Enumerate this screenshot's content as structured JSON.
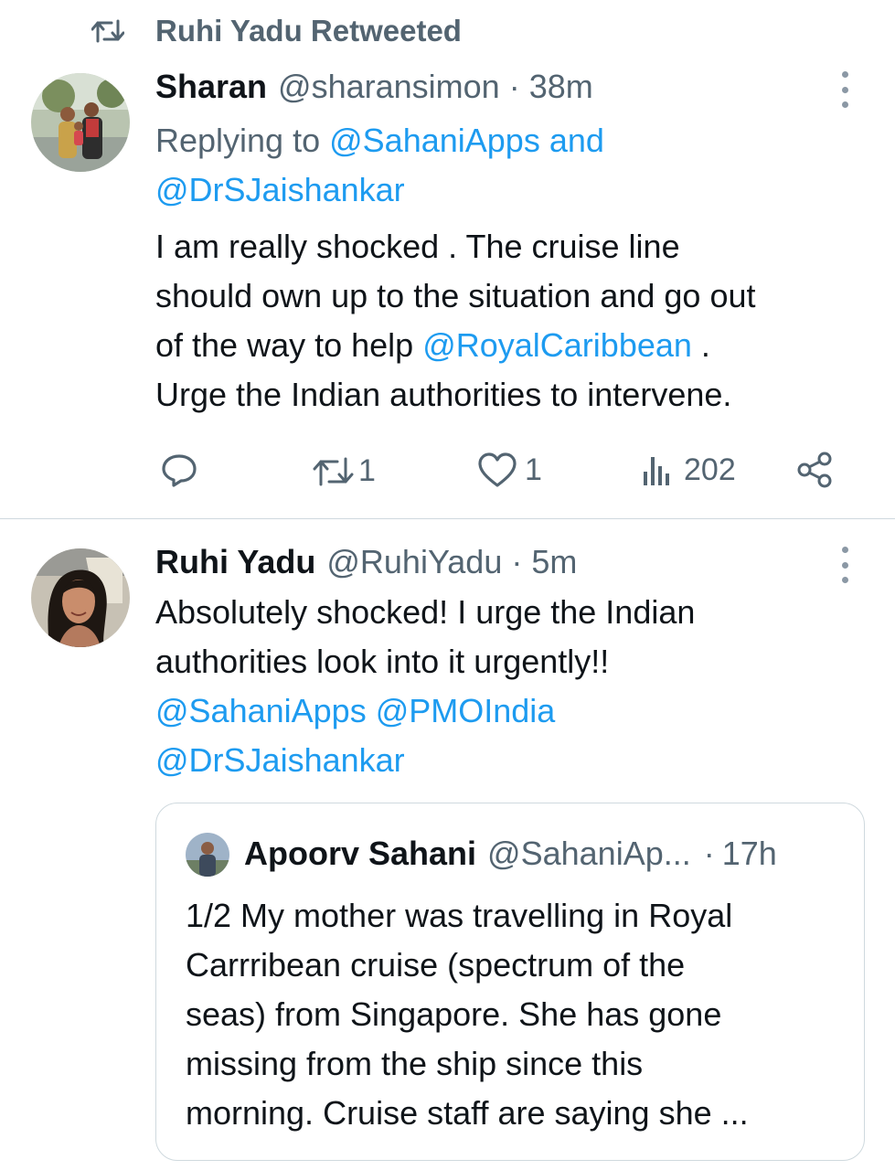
{
  "retweet_header": {
    "label": "Ruhi Yadu Retweeted",
    "icon": "retweet-icon"
  },
  "tweets": [
    {
      "name": "Sharan",
      "handle": "@sharansimon",
      "separator": "·",
      "time": "38m",
      "reply_prefix": "Replying to",
      "reply_handle_1": "@SahaniApps",
      "reply_and": "and",
      "reply_handle_2": "@DrSJaishankar",
      "text_line_1": "I am really shocked . The cruise line",
      "text_line_2": "should own up to the situation and go out",
      "text_line_3a": "of the way to help",
      "text_mention": "@RoyalCaribbean",
      "text_line_3b": ".",
      "text_line_4": "Urge the Indian authorities to intervene.",
      "actions": {
        "retweets": "1",
        "likes": "1",
        "views": "202"
      }
    },
    {
      "name": "Ruhi Yadu",
      "handle": "@RuhiYadu",
      "separator": "·",
      "time": "5m",
      "text_line_1": "Absolutely shocked! I urge the Indian",
      "text_line_2": "authorities look into it urgently!!",
      "mention_1": "@SahaniApps",
      "mention_2": "@PMOIndia",
      "mention_3": "@DrSJaishankar",
      "quote": {
        "name": "Apoorv Sahani",
        "handle": "@SahaniAp...",
        "separator": "·",
        "time": "17h",
        "lines": [
          "1/2 My mother was travelling in Royal",
          "Carrribean cruise (spectrum of the",
          "seas) from Singapore. She has gone",
          "missing from the ship since this",
          "morning. Cruise staff are saying she ..."
        ]
      }
    }
  ],
  "colors": {
    "link": "#1d9bf0",
    "muted": "#536471",
    "border": "#cfd9de",
    "text": "#0f1419"
  }
}
